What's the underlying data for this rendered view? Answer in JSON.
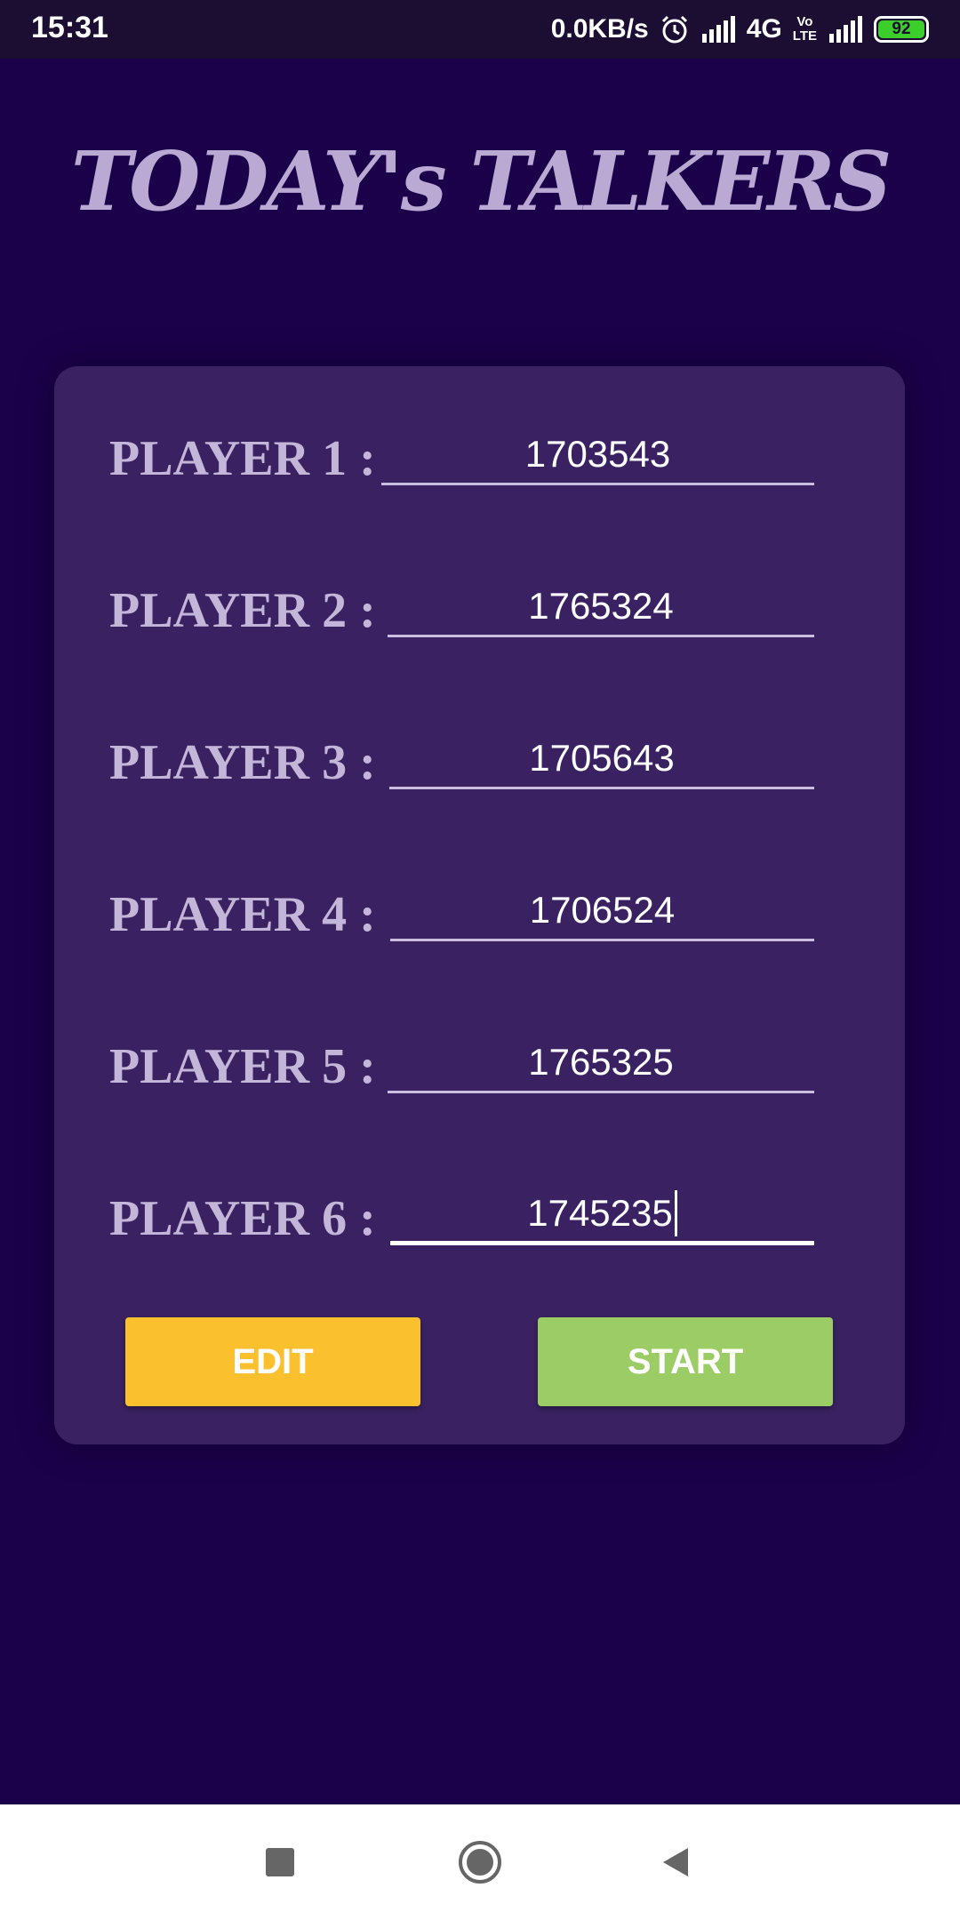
{
  "status_bar": {
    "time": "15:31",
    "network_speed": "0.0KB/s",
    "network_type": "4G",
    "volte_label_top": "Vo",
    "volte_label_bottom": "LTE",
    "battery_level": "92",
    "icons": [
      "alarm-icon",
      "signal-icon",
      "volte-icon",
      "signal-icon",
      "battery-icon"
    ]
  },
  "header": {
    "title": "TODAY's TALKERS"
  },
  "players": [
    {
      "label": "PLAYER 1 :",
      "value": "1703543"
    },
    {
      "label": "PLAYER 2 :",
      "value": "1765324"
    },
    {
      "label": "PLAYER 3 :",
      "value": "1705643"
    },
    {
      "label": "PLAYER 4 :",
      "value": "1706524"
    },
    {
      "label": "PLAYER 5 :",
      "value": "1765325"
    },
    {
      "label": "PLAYER 6 :",
      "value": "1745235"
    }
  ],
  "buttons": {
    "edit_label": "EDIT",
    "start_label": "START"
  },
  "colors": {
    "background": "#1b004a",
    "card": "#3a2262",
    "title": "#b9a9d3",
    "edit_button": "#fbc02d",
    "start_button": "#9ccc65"
  },
  "nav_bar": {
    "icons": [
      "recents-square-icon",
      "home-circle-icon",
      "back-triangle-icon"
    ]
  }
}
